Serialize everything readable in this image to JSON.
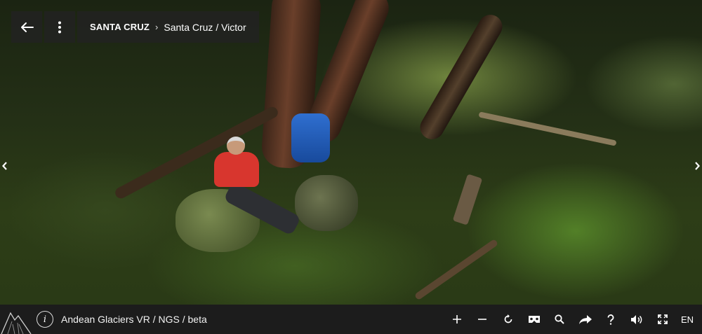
{
  "breadcrumb": {
    "root": "SANTA CRUZ",
    "leaf": "Santa Cruz / Victor"
  },
  "footer": {
    "title": "Andean Glaciers VR / NGS / beta",
    "info_icon": "info-icon",
    "logo_icon": "mountain-logo-icon",
    "language": "EN"
  },
  "toolbar": {
    "back_icon": "arrow-left-icon",
    "menu_icon": "more-vertical-icon"
  },
  "controls": [
    {
      "name": "zoom-in-button",
      "icon": "plus-icon"
    },
    {
      "name": "zoom-out-button",
      "icon": "minus-icon"
    },
    {
      "name": "auto-rotate-button",
      "icon": "rotate-icon"
    },
    {
      "name": "vr-mode-button",
      "icon": "vr-headset-icon"
    },
    {
      "name": "search-button",
      "icon": "search-icon"
    },
    {
      "name": "share-button",
      "icon": "share-arrow-icon"
    },
    {
      "name": "help-button",
      "icon": "question-icon"
    },
    {
      "name": "sound-button",
      "icon": "volume-icon"
    },
    {
      "name": "fullscreen-button",
      "icon": "fullscreen-icon"
    }
  ],
  "colors": {
    "bar_background": "#1c1c1c",
    "overlay_background": "#222222"
  }
}
